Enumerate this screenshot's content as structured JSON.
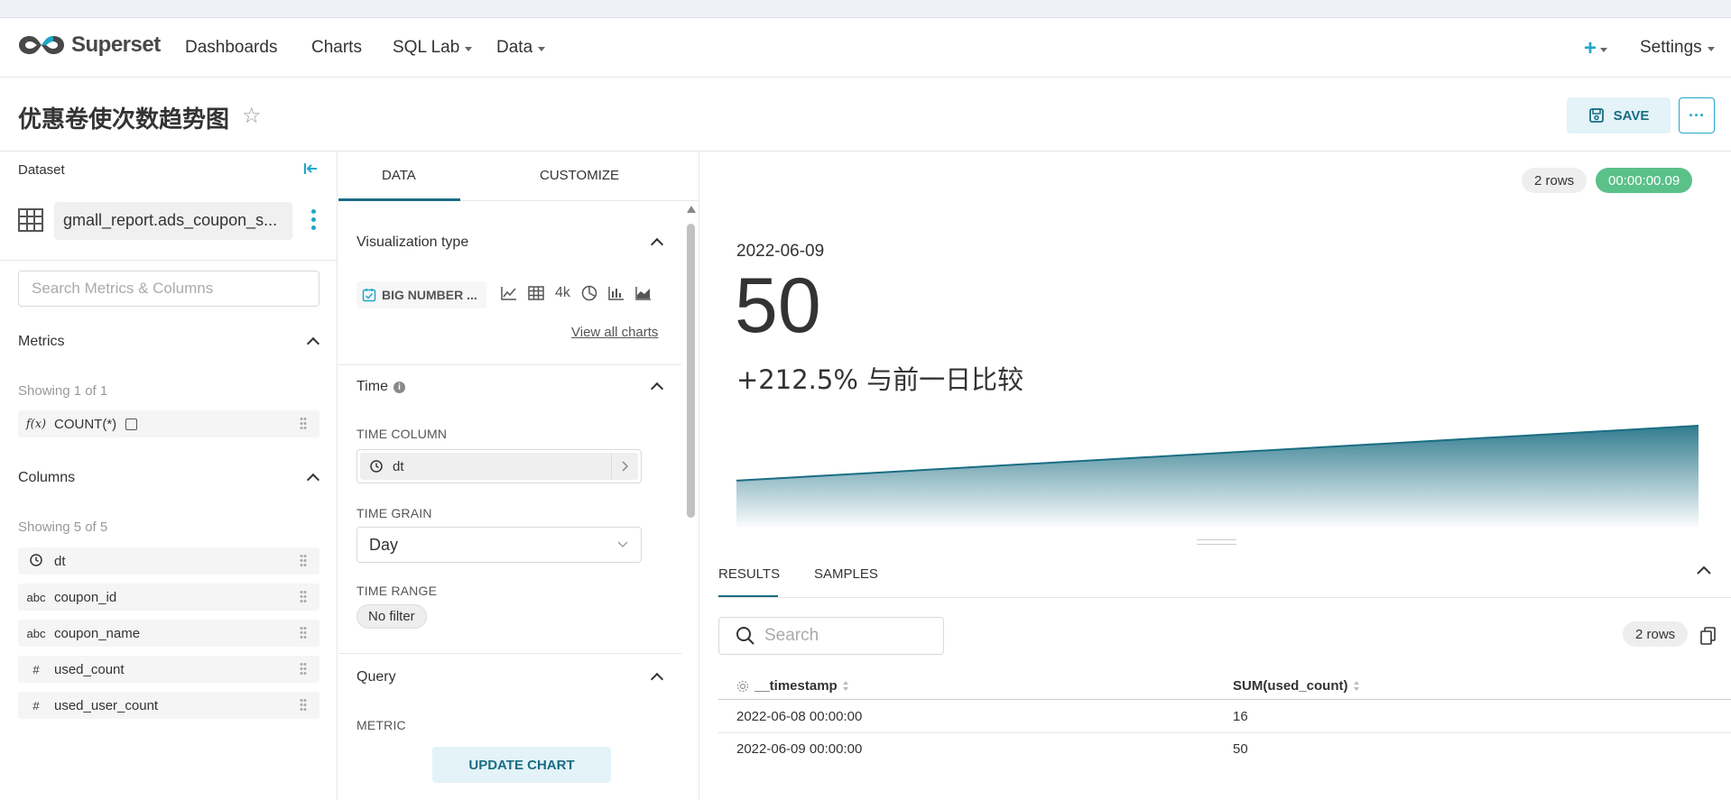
{
  "app": {
    "logo_text": "Superset",
    "nav": [
      "Dashboards",
      "Charts",
      "SQL Lab",
      "Data"
    ],
    "settings_label": "Settings"
  },
  "chart_header": {
    "title": "优惠卷使次数趋势图",
    "save_label": "SAVE",
    "more_label": "···"
  },
  "dataset": {
    "label": "Dataset",
    "name": "gmall_report.ads_coupon_s...",
    "search_placeholder": "Search Metrics & Columns",
    "metrics": {
      "heading": "Metrics",
      "showing": "Showing 1 of 1",
      "items": [
        {
          "type": "f(x)",
          "name": "COUNT(*)"
        }
      ]
    },
    "columns": {
      "heading": "Columns",
      "showing": "Showing 5 of 5",
      "items": [
        {
          "type": "clock",
          "name": "dt"
        },
        {
          "type": "abc",
          "name": "coupon_id"
        },
        {
          "type": "abc",
          "name": "coupon_name"
        },
        {
          "type": "#",
          "name": "used_count"
        },
        {
          "type": "#",
          "name": "used_user_count"
        }
      ]
    }
  },
  "controls": {
    "tabs": [
      "DATA",
      "CUSTOMIZE"
    ],
    "viz_type_heading": "Visualization type",
    "viz_type_selected": "BIG NUMBER ...",
    "viz_icon_text": "4k",
    "view_all": "View all charts",
    "time_heading": "Time",
    "time_column_label": "TIME COLUMN",
    "time_column_value": "dt",
    "time_grain_label": "TIME GRAIN",
    "time_grain_value": "Day",
    "time_range_label": "TIME RANGE",
    "time_range_value": "No filter",
    "query_heading": "Query",
    "metric_label": "METRIC",
    "update_label": "UPDATE CHART"
  },
  "chart": {
    "rows_badge": "2 rows",
    "time_badge": "00:00:00.09",
    "time_badge_color": "#5ac189",
    "accent_color": "#1a6d83",
    "big_number_date": "2022-06-09",
    "big_number_value": "50",
    "comparison_text": "+212.5% 与前一日比较"
  },
  "chart_data": {
    "type": "area",
    "x": [
      "2022-06-08",
      "2022-06-09"
    ],
    "series": [
      {
        "values": [
          16,
          50
        ]
      }
    ]
  },
  "results": {
    "tabs": [
      "RESULTS",
      "SAMPLES"
    ],
    "search_placeholder": "Search",
    "rows_badge": "2 rows",
    "columns": [
      "__timestamp",
      "SUM(used_count)"
    ],
    "rows": [
      [
        "2022-06-08 00:00:00",
        "16"
      ],
      [
        "2022-06-09 00:00:00",
        "50"
      ]
    ]
  }
}
